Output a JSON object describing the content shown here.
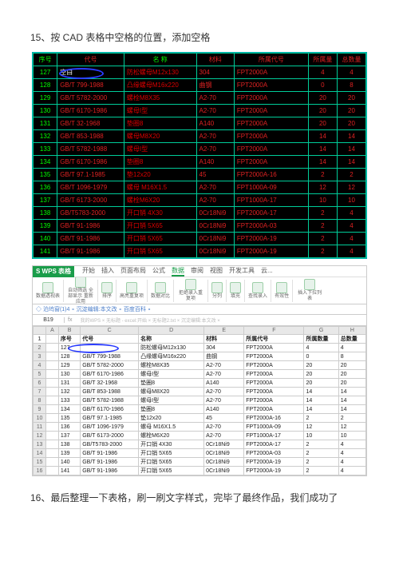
{
  "step15": "15、按 CAD 表格中空格的位置，添加空格",
  "step16": "16、最后整理一下表格，刷一刷文字样式，完毕了最终作品，我们成功了",
  "cad": {
    "headers": [
      "序号",
      "代号",
      "名 称",
      "材料",
      "所属代号",
      "所属量",
      "总数量"
    ],
    "rows": [
      [
        "127",
        "空白",
        "防松螺母M12x130",
        "304",
        "FPT2000A",
        "4",
        "4"
      ],
      [
        "128",
        "GB/T 799-1988",
        "凸缘螺母M16x220",
        "曲钢",
        "FPT2000A",
        "0",
        "8"
      ],
      [
        "129",
        "GB/T 5782-2000",
        "螺栓M8X35",
        "A2-70",
        "FPT2000A",
        "20",
        "20"
      ],
      [
        "130",
        "GB/T 6170-1986",
        "螺母I型",
        "A2-70",
        "FPT2000A",
        "20",
        "20"
      ],
      [
        "131",
        "GB/T 32-1968",
        "垫圈8",
        "A140",
        "FPT2000A",
        "20",
        "20"
      ],
      [
        "132",
        "GB/T 853-1988",
        "螺母M8X20",
        "A2-70",
        "FPT2000A",
        "14",
        "14"
      ],
      [
        "133",
        "GB/T 5782-1988",
        "螺母I型",
        "A2-70",
        "FPT2000A",
        "14",
        "14"
      ],
      [
        "134",
        "GB/T 6170-1986",
        "垫圈8",
        "A140",
        "FPT2000A",
        "14",
        "14"
      ],
      [
        "135",
        "GB/T 97.1-1985",
        "垫12x20",
        "45",
        "FPT2000A-16",
        "2",
        "2"
      ],
      [
        "136",
        "GB/T 1096-1979",
        "螺母 M16X1.5",
        "A2-70",
        "FPT1000A-09",
        "12",
        "12"
      ],
      [
        "137",
        "GB/T 6173-2000",
        "螺栓M6X20",
        "A2-70",
        "FPT1000A-17",
        "10",
        "10"
      ],
      [
        "138",
        "GB/T5783-2000",
        "开口销 4X30",
        "0Cr18Ni9",
        "FPT2000A-17",
        "2",
        "4"
      ],
      [
        "139",
        "GB/T 91-1986",
        "开口销 5X65",
        "0Cr18Ni9",
        "FPT2000A-03",
        "2",
        "4"
      ],
      [
        "140",
        "GB/T 91-1986",
        "开口销 5X65",
        "0Cr18Ni9",
        "FPT2000A-19",
        "2",
        "4"
      ],
      [
        "141",
        "GB/T 91-1986",
        "开口销 5X65",
        "0Cr18Ni9",
        "FPT2000A-19",
        "2",
        "4"
      ]
    ]
  },
  "wps": {
    "logo": "S WPS 表格",
    "tabs": [
      "开始",
      "插入",
      "页面布局",
      "公式",
      "数据",
      "审阅",
      "视图",
      "开发工具",
      "云..."
    ],
    "activeTab": 4,
    "ribbonItems": [
      "数据透视表",
      "自动筛选 全部显示 重新应用",
      "排序",
      "高亮重复项",
      "数据对比",
      "拒绝录入重复项",
      "分列",
      "填充",
      "查找录入",
      "有效性",
      "插入下拉列表"
    ],
    "cellRef": "B19",
    "fxLabel": "fx",
    "fxHint": "我的WPS × 无标题 - excel:开始 × 无标题2.txt × 沉淀编辑:本文改 ×",
    "linksRow": "◇ 泊坞窗(1)4 ∘ 沉淀编辑:本文改 ∘ 百度百科 ∘",
    "colHeaders": [
      "",
      "A",
      "B",
      "C",
      "D",
      "E",
      "F",
      "G",
      "H"
    ],
    "headerRow": [
      "1",
      "",
      "序号",
      "代号",
      "名称",
      "材料",
      "所属代号",
      "所属数量",
      "总数量"
    ],
    "rows": [
      [
        "2",
        "",
        "127",
        "",
        "防松螺母M12x130",
        "304",
        "FPT2000A",
        "4",
        "4"
      ],
      [
        "3",
        "",
        "128",
        "GB/T 799-1988",
        "凸缘螺母M16x220",
        "曲钢",
        "FPT2000A",
        "0",
        "8"
      ],
      [
        "4",
        "",
        "129",
        "GB/T 5782-2000",
        "螺栓M8X35",
        "A2-70",
        "FPT2000A",
        "20",
        "20"
      ],
      [
        "5",
        "",
        "130",
        "GB/T 6170-1986",
        "螺母I型",
        "A2-70",
        "FPT2000A",
        "20",
        "20"
      ],
      [
        "6",
        "",
        "131",
        "GB/T 32-1968",
        "垫圈8",
        "A140",
        "FPT2000A",
        "20",
        "20"
      ],
      [
        "7",
        "",
        "132",
        "GB/T 853-1988",
        "螺母M8X20",
        "A2-70",
        "FPT2000A",
        "14",
        "14"
      ],
      [
        "8",
        "",
        "133",
        "GB/T 5782-1988",
        "螺母I型",
        "A2-70",
        "FPT2000A",
        "14",
        "14"
      ],
      [
        "9",
        "",
        "134",
        "GB/T 6170-1986",
        "垫圈8",
        "A140",
        "FPT2000A",
        "14",
        "14"
      ],
      [
        "10",
        "",
        "135",
        "GB/T 97.1-1985",
        "垫12x20",
        "45",
        "FPT2000A-16",
        "2",
        "2"
      ],
      [
        "11",
        "",
        "136",
        "GB/T 1096-1979",
        "螺母 M16X1.5",
        "A2-70",
        "FPT1000A-09",
        "12",
        "12"
      ],
      [
        "12",
        "",
        "137",
        "GB/T 6173-2000",
        "螺栓M6X20",
        "A2-70",
        "FPT1000A-17",
        "10",
        "10"
      ],
      [
        "13",
        "",
        "138",
        "GB/T5783-2000",
        "开口销 4X30",
        "0Cr18Ni9",
        "FPT2000A-17",
        "2",
        "4"
      ],
      [
        "14",
        "",
        "139",
        "GB/T 91-1986",
        "开口销 5X65",
        "0Cr18Ni9",
        "FPT2000A-03",
        "2",
        "4"
      ],
      [
        "15",
        "",
        "140",
        "GB/T 91-1986",
        "开口销 5X65",
        "0Cr18Ni9",
        "FPT2000A-19",
        "2",
        "4"
      ],
      [
        "16",
        "",
        "141",
        "GB/T 91-1986",
        "开口销 5X65",
        "0Cr18Ni9",
        "FPT2000A-19",
        "2",
        "4"
      ]
    ]
  }
}
